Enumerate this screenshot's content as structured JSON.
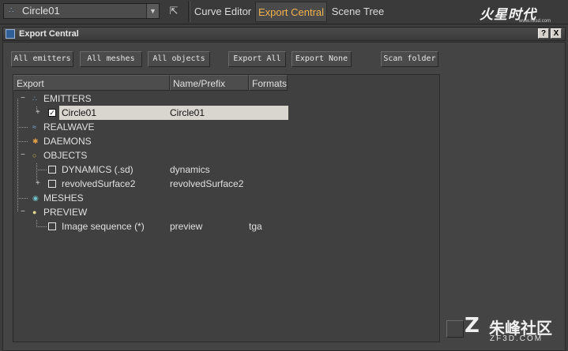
{
  "toolbar": {
    "node_selector": "Circle01",
    "node_icon": "particle-emitter-icon",
    "pick_icon": "pick-cursor-icon",
    "tabs": [
      "Curve Editor",
      "Export Central",
      "Scene Tree"
    ],
    "active_tab": "Export Central",
    "logo_text": "火星时代",
    "logo_sub": "www.hxsd.com"
  },
  "window": {
    "title": "Export Central",
    "help_label": "?",
    "close_label": "X"
  },
  "buttons": {
    "all_emitters": "All emitters",
    "all_meshes": "All meshes",
    "all_objects": "All objects",
    "export_all": "Export All",
    "export_none": "Export None",
    "scan_folder": "Scan folder"
  },
  "tree": {
    "columns": [
      "Export",
      "Name/Prefix",
      "Formats"
    ],
    "rows": [
      {
        "label": "EMITTERS",
        "name": "",
        "format": ""
      },
      {
        "label": "Circle01",
        "name": "Circle01",
        "format": "",
        "checked": true
      },
      {
        "label": "REALWAVE",
        "name": "",
        "format": ""
      },
      {
        "label": "DAEMONS",
        "name": "",
        "format": ""
      },
      {
        "label": "OBJECTS",
        "name": "",
        "format": ""
      },
      {
        "label": "DYNAMICS (.sd)",
        "name": "dynamics",
        "format": "",
        "checked": false
      },
      {
        "label": "revolvedSurface2",
        "name": "revolvedSurface2",
        "format": "",
        "checked": false
      },
      {
        "label": "MESHES",
        "name": "",
        "format": ""
      },
      {
        "label": "PREVIEW",
        "name": "",
        "format": ""
      },
      {
        "label": "Image sequence (*)",
        "name": "preview",
        "format": "tga",
        "checked": false
      }
    ],
    "check_glyph": "✓"
  },
  "watermark": {
    "mark": "Z",
    "cn": "朱峰社区",
    "en": "ZF3D.COM"
  },
  "colors": {
    "accent_tab": "#f2b24e",
    "selection": "#d9d6cf",
    "panel_bg": "#444444"
  }
}
